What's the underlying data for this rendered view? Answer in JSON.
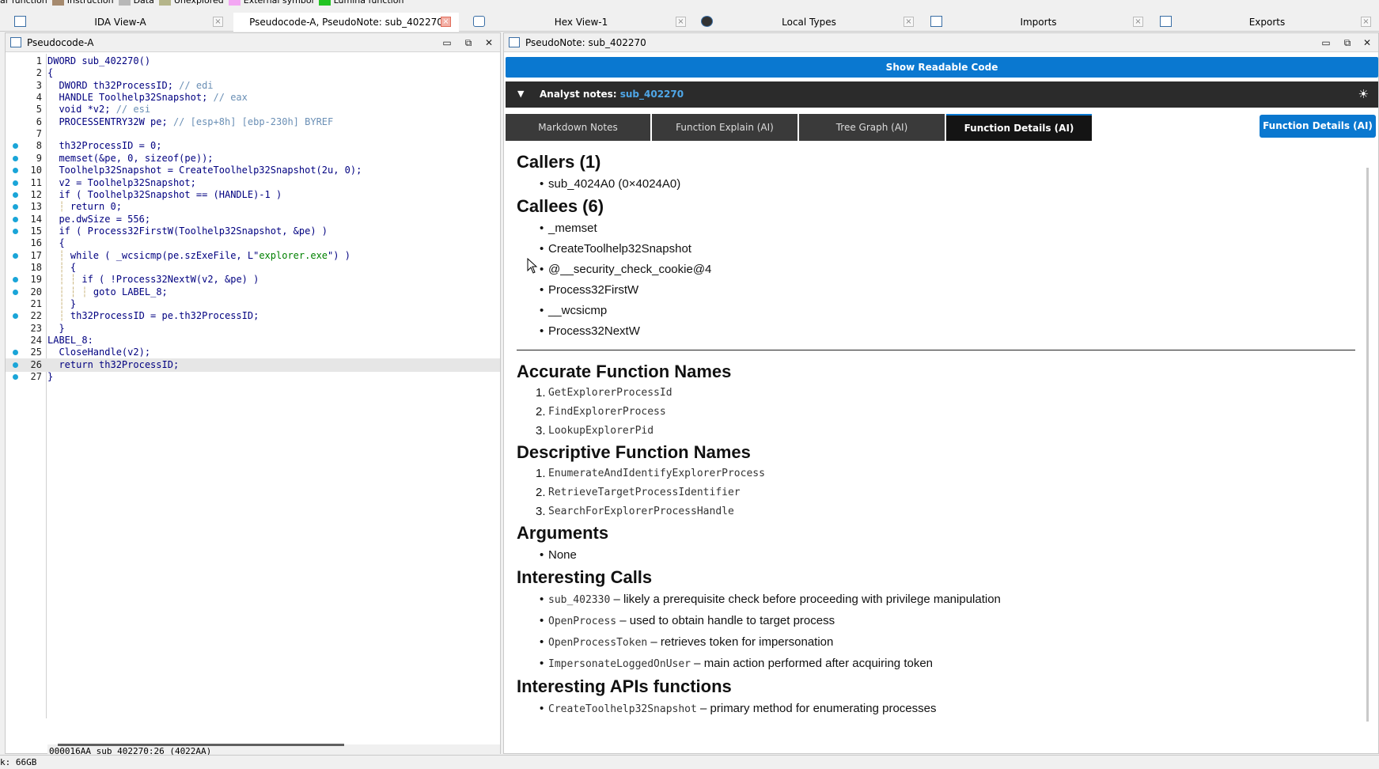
{
  "legend": [
    {
      "label": "ar function",
      "color": "#8a6a4f"
    },
    {
      "label": "Instruction",
      "color": "#a68a6e"
    },
    {
      "label": "Data",
      "color": "#b8b8b8"
    },
    {
      "label": "Unexplored",
      "color": "#b5b58a"
    },
    {
      "label": "External symbol",
      "color": "#f3a6f3"
    },
    {
      "label": "Lumina function",
      "color": "#22c422"
    }
  ],
  "tabs": [
    {
      "label": "IDA View-A",
      "icon": "disasm-icon"
    },
    {
      "label": "Pseudocode-A, PseudoNote: sub_402270",
      "icon": "pseudocode-icon"
    },
    {
      "label": "Hex View-1",
      "icon": "hex-icon"
    },
    {
      "label": "Local Types",
      "icon": "local-types-icon"
    },
    {
      "label": "Imports",
      "icon": "imports-icon"
    },
    {
      "label": "Exports",
      "icon": "exports-icon"
    }
  ],
  "tab_close_glyph": "×",
  "left_panel": {
    "title": "Pseudocode-A",
    "status": "000016AA sub_402270:26 (4022AA)",
    "code_lines": [
      {
        "n": "1",
        "bp": false,
        "text": "DWORD sub_402270()"
      },
      {
        "n": "2",
        "bp": false,
        "text": "{"
      },
      {
        "n": "3",
        "bp": false,
        "text": "  DWORD th32ProcessID; // edi"
      },
      {
        "n": "4",
        "bp": false,
        "text": "  HANDLE Toolhelp32Snapshot; // eax"
      },
      {
        "n": "5",
        "bp": false,
        "text": "  void *v2; // esi"
      },
      {
        "n": "6",
        "bp": false,
        "text": "  PROCESSENTRY32W pe; // [esp+8h] [ebp-230h] BYREF"
      },
      {
        "n": "7",
        "bp": false,
        "text": ""
      },
      {
        "n": "8",
        "bp": true,
        "text": "  th32ProcessID = 0;"
      },
      {
        "n": "9",
        "bp": true,
        "text": "  memset(&pe, 0, sizeof(pe));"
      },
      {
        "n": "10",
        "bp": true,
        "text": "  Toolhelp32Snapshot = CreateToolhelp32Snapshot(2u, 0);"
      },
      {
        "n": "11",
        "bp": true,
        "text": "  v2 = Toolhelp32Snapshot;"
      },
      {
        "n": "12",
        "bp": true,
        "text": "  if ( Toolhelp32Snapshot == (HANDLE)-1 )"
      },
      {
        "n": "13",
        "bp": true,
        "text": "  ┆ return 0;"
      },
      {
        "n": "14",
        "bp": true,
        "text": "  pe.dwSize = 556;"
      },
      {
        "n": "15",
        "bp": true,
        "text": "  if ( Process32FirstW(Toolhelp32Snapshot, &pe) )"
      },
      {
        "n": "16",
        "bp": false,
        "text": "  {"
      },
      {
        "n": "17",
        "bp": true,
        "text": "  ┆ while ( _wcsicmp(pe.szExeFile, L\"explorer.exe\") )"
      },
      {
        "n": "18",
        "bp": false,
        "text": "  ┆ {"
      },
      {
        "n": "19",
        "bp": true,
        "text": "  ┆ ┆ if ( !Process32NextW(v2, &pe) )"
      },
      {
        "n": "20",
        "bp": true,
        "text": "  ┆ ┆ ┆ goto LABEL_8;"
      },
      {
        "n": "21",
        "bp": false,
        "text": "  ┆ }"
      },
      {
        "n": "22",
        "bp": true,
        "text": "  ┆ th32ProcessID = pe.th32ProcessID;"
      },
      {
        "n": "23",
        "bp": false,
        "text": "  }"
      },
      {
        "n": "24",
        "bp": false,
        "text": "LABEL_8:"
      },
      {
        "n": "25",
        "bp": true,
        "text": "  CloseHandle(v2);"
      },
      {
        "n": "26",
        "bp": true,
        "text": "  return th32ProcessID;"
      },
      {
        "n": "27",
        "bp": true,
        "text": "}"
      }
    ],
    "highlighted_line": "26"
  },
  "right_panel": {
    "title": "PseudoNote: sub_402270",
    "show_code_label": "Show Readable Code",
    "collapse_glyph": "▼",
    "notes_label": "Analyst notes:",
    "notes_function": "sub_402270",
    "theme_icon_glyph": "☀",
    "tabs": [
      {
        "label": "Markdown Notes",
        "active": false
      },
      {
        "label": "Function Explain (AI)",
        "active": false
      },
      {
        "label": "Tree Graph (AI)",
        "active": false
      },
      {
        "label": "Function Details (AI)",
        "active": true
      }
    ],
    "action_button": "Function Details (AI)",
    "callers_heading": "Callers (1)",
    "callers": [
      "sub_4024A0 (0×4024A0)"
    ],
    "callees_heading": "Callees (6)",
    "callees": [
      "_memset",
      "CreateToolhelp32Snapshot",
      "@__security_check_cookie@4",
      "Process32FirstW",
      "__wcsicmp",
      "Process32NextW"
    ],
    "accurate_heading": "Accurate Function Names",
    "accurate": [
      "GetExplorerProcessId",
      "FindExplorerProcess",
      "LookupExplorerPid"
    ],
    "descriptive_heading": "Descriptive Function Names",
    "descriptive": [
      "EnumerateAndIdentifyExplorerProcess",
      "RetrieveTargetProcessIdentifier",
      "SearchForExplorerProcessHandle"
    ],
    "arguments_heading": "Arguments",
    "arguments": [
      "None"
    ],
    "calls_heading": "Interesting Calls",
    "calls": [
      {
        "name": "sub_402330",
        "desc": " – likely a prerequisite check before proceeding with privilege manipulation"
      },
      {
        "name": "OpenProcess",
        "desc": " – used to obtain handle to target process"
      },
      {
        "name": "OpenProcessToken",
        "desc": " – retrieves token for impersonation"
      },
      {
        "name": "ImpersonateLoggedOnUser",
        "desc": " – main action performed after acquiring token"
      }
    ],
    "apis_heading": "Interesting APIs functions",
    "apis": [
      {
        "name": "CreateToolhelp32Snapshot",
        "desc": " – primary method for enumerating processes"
      }
    ]
  },
  "window_buttons": {
    "minimize": "▭",
    "restore": "⧉",
    "close": "✕"
  },
  "bottom_status": "k: 66GB"
}
